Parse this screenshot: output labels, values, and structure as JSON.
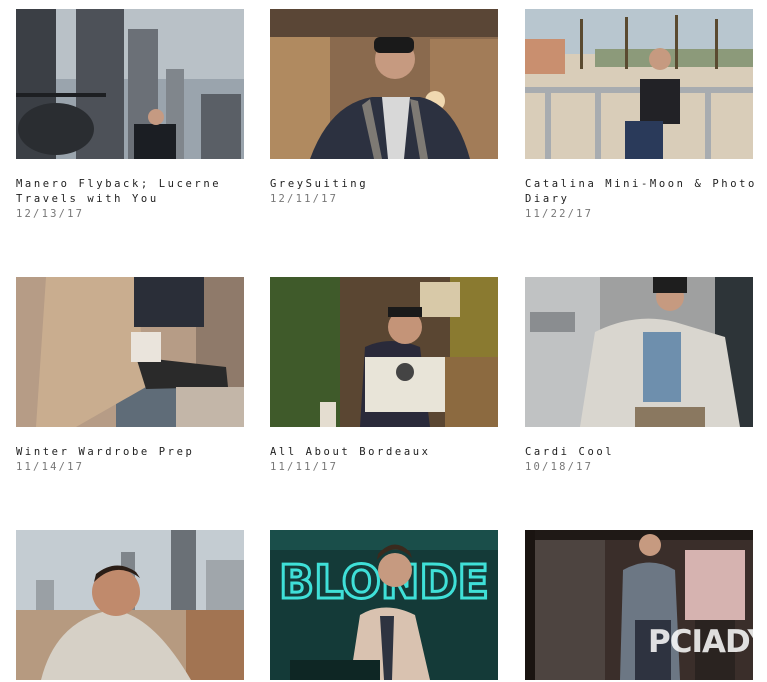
{
  "posts": [
    {
      "title": "Manero Flyback; Lucerne Travels with You",
      "date": "12/13/17"
    },
    {
      "title": "GreySuiting",
      "date": "12/11/17"
    },
    {
      "title": "Catalina Mini-Moon & Photo Diary",
      "date": "11/22/17"
    },
    {
      "title": "Winter Wardrobe Prep",
      "date": "11/14/17"
    },
    {
      "title": "All About Bordeaux",
      "date": "11/11/17"
    },
    {
      "title": "Cardi Cool",
      "date": "10/18/17"
    }
  ],
  "watermark": "PCIADY",
  "neon_sign": "BLONDE",
  "colors": {
    "title_text": "#1e1e1e",
    "date_text": "#777777",
    "neon": "#3fe0d8"
  }
}
